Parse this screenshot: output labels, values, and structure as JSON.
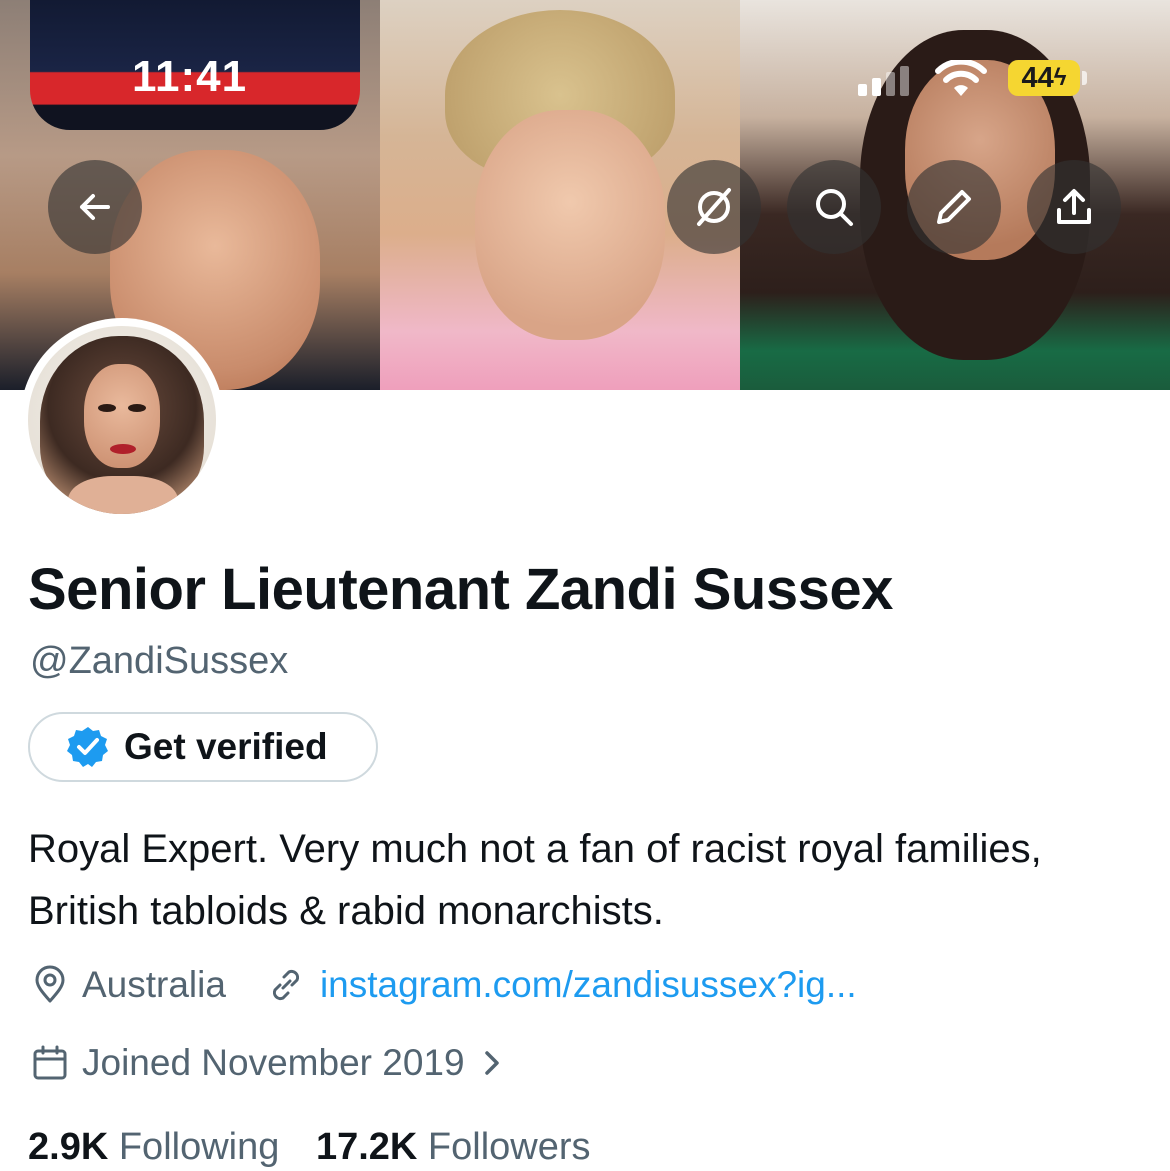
{
  "status_bar": {
    "time": "11:41",
    "battery": "44"
  },
  "header_buttons": {
    "back_icon": "arrow-left-icon",
    "grok_icon": "slash-circle-icon",
    "search_icon": "search-icon",
    "edit_icon": "pencil-icon",
    "share_icon": "share-upload-icon"
  },
  "profile": {
    "display_name": "Senior Lieutenant Zandi Sussex",
    "handle": "@ZandiSussex",
    "get_verified_label": "Get verified",
    "bio": "Royal Expert. Very much not a fan of racist royal families, British tabloids & rabid monarchists.",
    "location": "Australia",
    "website": "instagram.com/zandisussex?ig...",
    "joined": "Joined November 2019",
    "following_count": "2.9K",
    "following_label": "Following",
    "followers_count": "17.2K",
    "followers_label": "Followers"
  },
  "colors": {
    "link": "#1d9bf0",
    "secondary_text": "#536471",
    "verified_badge": "#1d9bf0",
    "battery": "#f5d631"
  }
}
